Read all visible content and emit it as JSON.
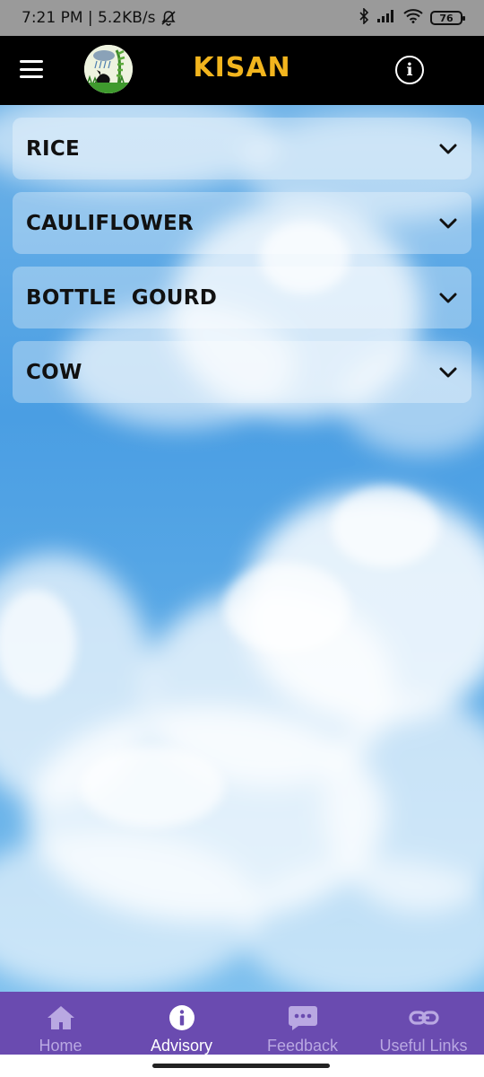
{
  "status_bar": {
    "text": "7:21 PM | 5.2KB/s",
    "battery": "76",
    "icons": [
      "bell-off-icon",
      "bluetooth-icon",
      "signal-icon",
      "wifi-icon",
      "battery-icon"
    ]
  },
  "app_bar": {
    "title": "KISAN",
    "title_color": "#f2b51e",
    "icons": [
      "menu-icon",
      "logo",
      "info-icon"
    ]
  },
  "advisory": {
    "items": [
      {
        "label": "RICE"
      },
      {
        "label": "CAULIFLOWER"
      },
      {
        "label": "BOTTLE  GOURD"
      },
      {
        "label": "COW"
      }
    ]
  },
  "bottom_nav": {
    "background": "#6a4bb0",
    "active": "Advisory",
    "items": [
      {
        "label": "Home",
        "icon": "home-icon"
      },
      {
        "label": "Advisory",
        "icon": "info-icon"
      },
      {
        "label": "Feedback",
        "icon": "chat-icon"
      },
      {
        "label": "Useful Links",
        "icon": "link-icon"
      }
    ]
  }
}
